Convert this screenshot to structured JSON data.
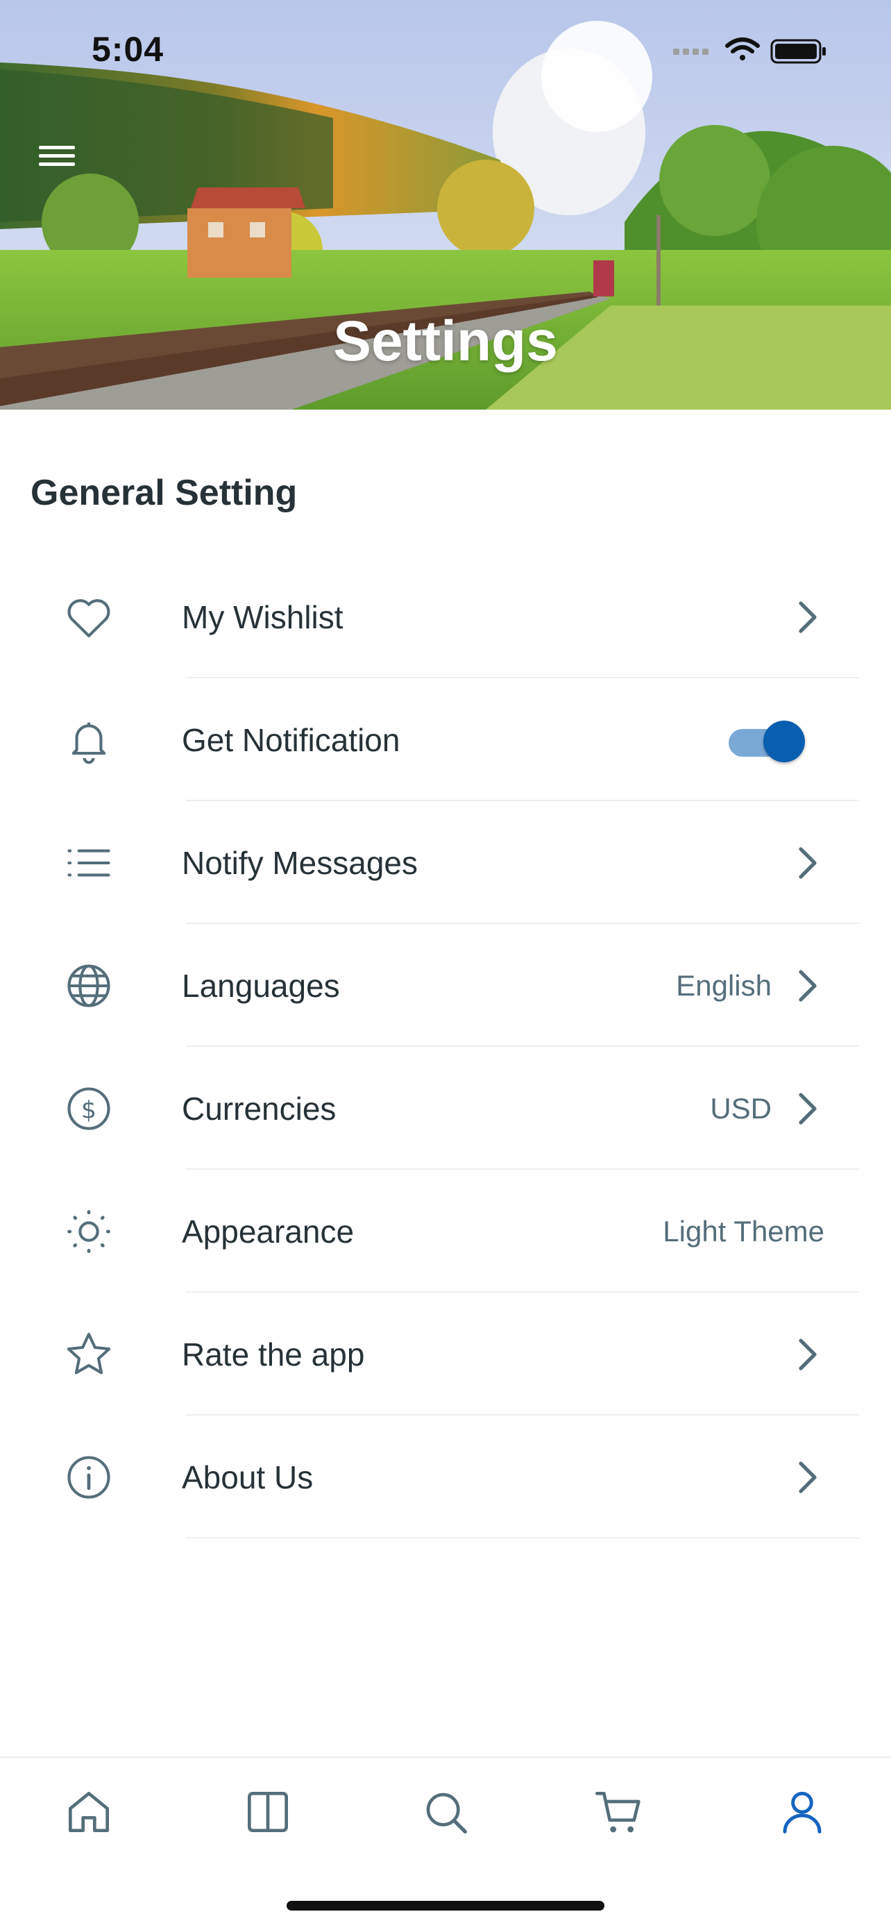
{
  "status_bar": {
    "time": "5:04"
  },
  "hero": {
    "title": "Settings"
  },
  "section": {
    "title": "General Setting"
  },
  "settings": [
    {
      "id": "wishlist",
      "icon": "heart-icon",
      "label": "My Wishlist",
      "value": "",
      "control": "chevron"
    },
    {
      "id": "notification",
      "icon": "bell-icon",
      "label": "Get Notification",
      "value": "",
      "control": "toggle",
      "toggle_on": true
    },
    {
      "id": "messages",
      "icon": "list-icon",
      "label": "Notify Messages",
      "value": "",
      "control": "chevron"
    },
    {
      "id": "languages",
      "icon": "globe-icon",
      "label": "Languages",
      "value": "English",
      "control": "chevron"
    },
    {
      "id": "currencies",
      "icon": "dollar-icon",
      "label": "Currencies",
      "value": "USD",
      "control": "chevron"
    },
    {
      "id": "appearance",
      "icon": "sun-icon",
      "label": "Appearance",
      "value": "Light Theme",
      "control": "none"
    },
    {
      "id": "rate",
      "icon": "star-icon",
      "label": "Rate the app",
      "value": "",
      "control": "chevron"
    },
    {
      "id": "about",
      "icon": "info-icon",
      "label": "About Us",
      "value": "",
      "control": "chevron"
    }
  ],
  "tabbar": {
    "items": [
      {
        "icon": "home-icon",
        "active": false
      },
      {
        "icon": "book-icon",
        "active": false
      },
      {
        "icon": "search-icon",
        "active": false
      },
      {
        "icon": "cart-icon",
        "active": false
      },
      {
        "icon": "user-icon",
        "active": true
      }
    ]
  },
  "colors": {
    "accent": "#0a5eb0",
    "icon": "#546e7a",
    "text": "#263238",
    "active_tab": "#1565c0"
  }
}
